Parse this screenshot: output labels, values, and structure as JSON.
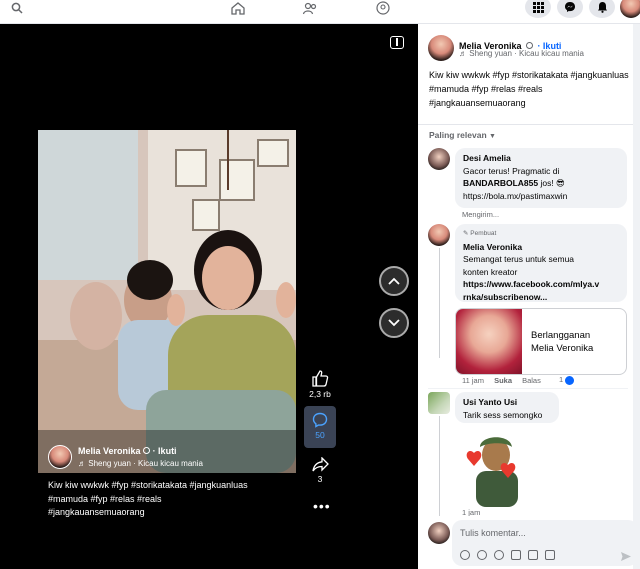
{
  "video": {
    "author": "Melia Veronika",
    "follow": "· Ikuti",
    "music": "Sheng yuan · Kicau kicau mania",
    "caption_lines": [
      "Kiw kiw wwkwk  #fyp  #storikatakata  #jangkuanluas",
      "#mamuda  #fyp  #relas  #reals",
      "#jangkauansemuaorang"
    ],
    "likes": "2,3 rb",
    "comments": "50",
    "shares": "3"
  },
  "panel": {
    "author": "Melia Veronika",
    "follow": "· Ikuti",
    "music": "Sheng yuan · Kicau kicau mania",
    "caption": "Kiw kiw wwkwk  #fyp  #storikatakata #jangkuanluas  #mamuda  #fyp  #relas  #reals  #jangkauansemuaorang",
    "sort_label": "Paling relevan"
  },
  "comments": [
    {
      "name": "Desi Amelia",
      "line1": "Gacor terus! Pragmatic di",
      "line2": "BANDARBOLA855",
      "line2b": "jos! 😎",
      "line3": "https://bola.mx/pastimaxwin",
      "status": "Mengirim..."
    },
    {
      "badge": "Pembuat",
      "name": "Melia Veronika",
      "line1": "Semangat terus untuk semua",
      "line2": "konten kreator",
      "link1": "https://www.facebook.com/mlya.v",
      "link2": "rnka/subscribenow...",
      "card_line1": "Berlangganan",
      "card_line2": "Melia Veronika",
      "time": "11 jam",
      "like": "Suka",
      "reply": "Balas",
      "count": "1"
    },
    {
      "name": "Usi Yanto Usi",
      "text": "Tarik sess semongko",
      "time": "1 jam"
    }
  ],
  "compose": {
    "placeholder": "Tulis komentar..."
  }
}
